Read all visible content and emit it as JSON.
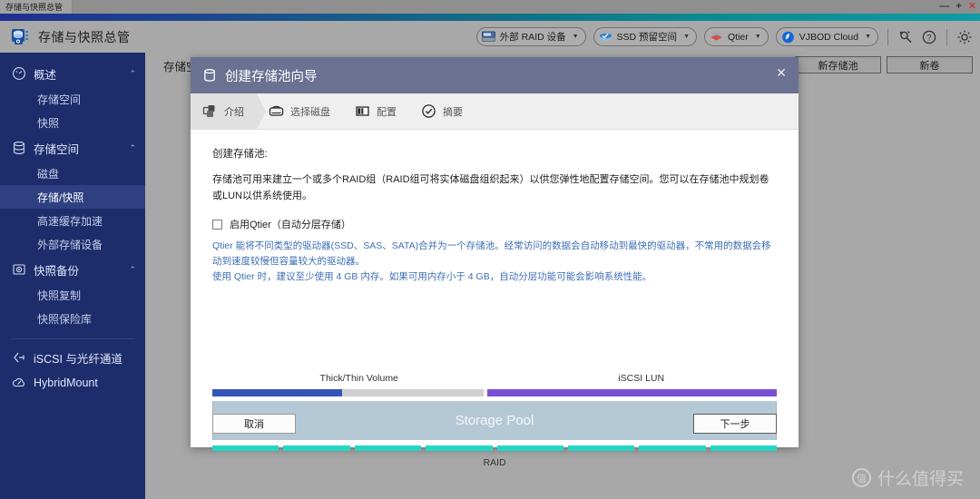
{
  "window": {
    "tab_title": "存储与快照总管",
    "controls": {
      "minimize": "—",
      "maximize": "+",
      "close": "✕"
    }
  },
  "header": {
    "app_title": "存储与快照总管",
    "logo_icon": "storage-snapshot-manager-icon",
    "buttons": [
      {
        "label": "外部 RAID 设备",
        "icon": "external-raid-icon",
        "caret": "▼"
      },
      {
        "label": "SSD 预留空间",
        "icon": "ssd-overprovisioning-icon",
        "caret": "▼"
      },
      {
        "label": "Qtier",
        "icon": "qtier-icon",
        "caret": "▼"
      },
      {
        "label": "VJBOD Cloud",
        "icon": "vjbod-cloud-icon",
        "caret": "▼"
      }
    ],
    "icons": [
      {
        "name": "search-wand-icon",
        "glyph": "🔍"
      },
      {
        "name": "help-icon",
        "glyph": "?"
      },
      {
        "name": "settings-gear-icon",
        "glyph": "⚙"
      }
    ]
  },
  "sidebar": {
    "groups": [
      {
        "label": "概述",
        "icon": "dashboard-icon",
        "chevron": "⌃",
        "items": [
          {
            "label": "存储空间",
            "active": false
          },
          {
            "label": "快照",
            "active": false
          }
        ]
      },
      {
        "label": "存储空间",
        "icon": "storage-icon",
        "chevron": "⌃",
        "items": [
          {
            "label": "磁盘",
            "active": false
          },
          {
            "label": "存储/快照",
            "active": true
          },
          {
            "label": "高速缓存加速",
            "active": false
          },
          {
            "label": "外部存储设备",
            "active": false
          }
        ]
      },
      {
        "label": "快照备份",
        "icon": "snapshot-backup-icon",
        "chevron": "⌃",
        "items": [
          {
            "label": "快照复制",
            "active": false
          },
          {
            "label": "快照保险库",
            "active": false
          }
        ]
      }
    ],
    "links": [
      {
        "label": "iSCSI 与光纤通道",
        "icon": "iscsi-fibre-channel-icon"
      },
      {
        "label": "HybridMount",
        "icon": "hybridmount-icon"
      }
    ]
  },
  "main": {
    "background_tab_text": "存储空",
    "buttons": [
      {
        "label": "新存储池"
      },
      {
        "label": "新卷"
      }
    ]
  },
  "dialog": {
    "title": "创建存储池向导",
    "title_icon": "storage-pool-cylinder-icon",
    "close_label": "✕",
    "steps": [
      {
        "label": "介绍",
        "icon": "intro-icon",
        "active": true
      },
      {
        "label": "选择磁盘",
        "icon": "select-disks-icon",
        "active": false
      },
      {
        "label": "配置",
        "icon": "configure-icon",
        "active": false
      },
      {
        "label": "摘要",
        "icon": "summary-check-icon",
        "active": false
      }
    ],
    "body": {
      "heading": "创建存储池:",
      "paragraph": "存储池可用来建立一个或多个RAID组（RAID组可将实体磁盘组织起来）以供您弹性地配置存储空间。您可以在存储池中规划卷或LUN以供系统使用。",
      "checkbox_label": "启用Qtier（自动分层存储）",
      "checkbox_checked": false,
      "note_line1": "Qtier 能将不同类型的驱动器(SSD、SAS、SATA)合并为一个存储池。经常访问的数据会自动移动到最快的驱动器，不常用的数据会移动到速度较慢但容量较大的驱动器。",
      "note_line2": "使用 Qtier 时，建议至少使用 4 GB 内存。如果可用内存小于 4 GB，自动分层功能可能会影响系统性能。"
    },
    "diagram": {
      "label_volume": "Thick/Thin Volume",
      "label_lun": "iSCSI LUN",
      "pool_label": "Storage Pool",
      "raid_label": "RAID",
      "raid_segments": 8,
      "volume_fill_percent": 48,
      "colors": {
        "volume_fill": "#3455b8",
        "volume_track": "#cfcfcf",
        "lun": "#7a4fd4",
        "pool": "#b5c8d6",
        "raid": "#25d6c4"
      }
    },
    "footer": {
      "cancel_label": "取消",
      "next_label": "下一步"
    }
  },
  "watermark": {
    "badge": "值",
    "text": "什么值得买"
  }
}
